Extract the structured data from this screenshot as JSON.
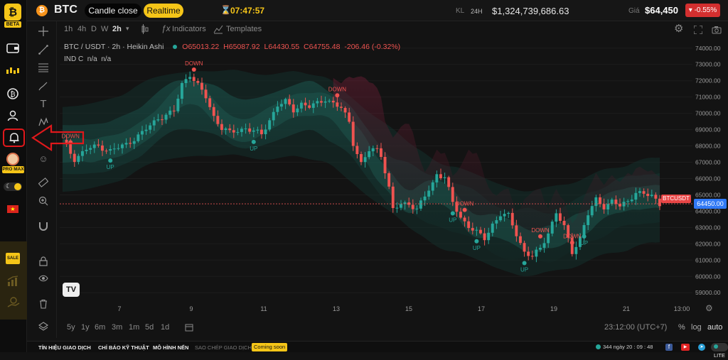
{
  "app": {
    "logo_badge": "BETA",
    "symbol": "BTC",
    "mode_candle_close": "Candle close",
    "mode_realtime": "Realtime",
    "clock": "07:47:57",
    "kl_label": "KL",
    "kl_period": "24H",
    "volume": "$1,324,739,686.63",
    "price_label": "Giá",
    "price": "$64,450",
    "change": "-0.55%"
  },
  "sidebar": {
    "pro_badge": "PRO MAX",
    "sale_badge": "SALE"
  },
  "toolbar": {
    "timeframes": [
      "1h",
      "4h",
      "D",
      "W",
      "2h"
    ],
    "indicators_label": "Indicators",
    "templates_label": "Templates"
  },
  "legend": {
    "pair": "BTC / USDT · 2h · Heikin Ashi",
    "open": "O65013.22",
    "high": "H65087.92",
    "low": "L64430.55",
    "close": "C64755.48",
    "delta": "-206.46 (-0.32%)",
    "indicator": "IND C  n/a  n/a"
  },
  "chart_data": {
    "type": "candlestick",
    "x_tick_labels": [
      "7",
      "9",
      "11",
      "13",
      "15",
      "17",
      "19",
      "21",
      "13:00"
    ],
    "y_tick_labels": [
      "74000.00",
      "73000.00",
      "72000.00",
      "71000.00",
      "70000.00",
      "69000.00",
      "68000.00",
      "67000.00",
      "66000.00",
      "65000.00",
      "64000.00",
      "63000.00",
      "62000.00",
      "61000.00",
      "60000.00",
      "59000.00"
    ],
    "ylim": [
      58400,
      74600
    ],
    "last_price": 64450,
    "last_price_label": "64450.00",
    "symbol_tag": "BTCUSDT",
    "close_path": [
      [
        0,
        68300
      ],
      [
        3,
        67200
      ],
      [
        6,
        67800
      ],
      [
        9,
        68000
      ],
      [
        12,
        67700
      ],
      [
        16,
        68100
      ],
      [
        20,
        68800
      ],
      [
        24,
        69700
      ],
      [
        28,
        70100
      ],
      [
        30,
        71800
      ],
      [
        32,
        72400
      ],
      [
        34,
        71700
      ],
      [
        36,
        71000
      ],
      [
        38,
        69800
      ],
      [
        40,
        69100
      ],
      [
        42,
        68800
      ],
      [
        46,
        69100
      ],
      [
        50,
        68700
      ],
      [
        52,
        69600
      ],
      [
        54,
        70500
      ],
      [
        56,
        70700
      ],
      [
        58,
        70200
      ],
      [
        60,
        70600
      ],
      [
        62,
        70400
      ],
      [
        64,
        70600
      ],
      [
        66,
        70900
      ],
      [
        68,
        70600
      ],
      [
        70,
        70300
      ],
      [
        72,
        69500
      ],
      [
        73,
        68200
      ],
      [
        75,
        66900
      ],
      [
        77,
        67700
      ],
      [
        79,
        67800
      ],
      [
        80,
        67500
      ],
      [
        82,
        65400
      ],
      [
        83,
        64100
      ],
      [
        85,
        64400
      ],
      [
        87,
        64500
      ],
      [
        89,
        64100
      ],
      [
        91,
        64900
      ],
      [
        93,
        65700
      ],
      [
        94,
        66300
      ],
      [
        96,
        66100
      ],
      [
        98,
        64500
      ],
      [
        100,
        63600
      ],
      [
        102,
        63100
      ],
      [
        104,
        62700
      ],
      [
        106,
        62300
      ],
      [
        108,
        63200
      ],
      [
        110,
        63800
      ],
      [
        112,
        63700
      ],
      [
        114,
        62600
      ],
      [
        116,
        61500
      ],
      [
        118,
        61200
      ],
      [
        120,
        61700
      ],
      [
        122,
        62700
      ],
      [
        124,
        63900
      ],
      [
        126,
        63000
      ],
      [
        128,
        61500
      ],
      [
        130,
        62400
      ],
      [
        132,
        63800
      ],
      [
        134,
        64700
      ],
      [
        136,
        64300
      ],
      [
        138,
        64600
      ],
      [
        140,
        64300
      ],
      [
        142,
        64600
      ],
      [
        144,
        65200
      ],
      [
        146,
        65000
      ],
      [
        148,
        64950
      ],
      [
        150,
        64450
      ]
    ],
    "signals": [
      {
        "text": "DOWN",
        "i": 2
      },
      {
        "text": "UP",
        "i": 12
      },
      {
        "text": "DOWN",
        "i": 33
      },
      {
        "text": "UP",
        "i": 48
      },
      {
        "text": "DOWN",
        "i": 69
      },
      {
        "text": "UP",
        "i": 98
      },
      {
        "text": "DOWN",
        "i": 101
      },
      {
        "text": "UP",
        "i": 104
      },
      {
        "text": "DOWN",
        "i": 120
      },
      {
        "text": "UP",
        "i": 116
      },
      {
        "text": "DOWN",
        "i": 128
      },
      {
        "text": "UP",
        "i": 131
      }
    ]
  },
  "bottombar": {
    "ranges": [
      "5y",
      "1y",
      "6m",
      "3m",
      "1m",
      "5d",
      "1d"
    ],
    "time": "23:12:00 (UTC+7)",
    "pct": "%",
    "log": "log",
    "auto": "auto"
  },
  "footer": {
    "tabs": [
      "TÍN HIỆU GIAO DỊCH",
      "CHỈ BÁO KỸ THUẬT",
      "MÔ HÌNH NẾN",
      "SAO CHÉP GIAO DỊCH"
    ],
    "coming_soon": "Coming soon",
    "stats": "344 ngày 20 : 09 : 48",
    "lite": "LITE"
  },
  "colors": {
    "bg": "#131313",
    "up": "#26a69a",
    "down": "#ef5350",
    "accent": "#f5c518",
    "alert": "#e0181b"
  }
}
